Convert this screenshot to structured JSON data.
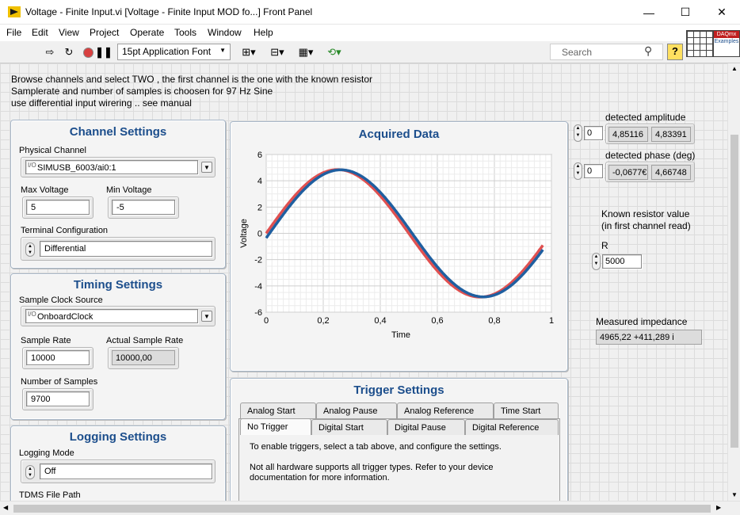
{
  "window": {
    "title": "Voltage - Finite Input.vi [Voltage - Finite Input MOD fo...] Front Panel",
    "minimize": "—",
    "maximize": "☐",
    "close": "✕"
  },
  "menu": [
    "File",
    "Edit",
    "View",
    "Project",
    "Operate",
    "Tools",
    "Window",
    "Help"
  ],
  "toolbar": {
    "font": "15pt Application Font",
    "search_placeholder": "Search"
  },
  "intro": [
    "Browse channels and select TWO , the first channel is the one with the known resistor",
    "Samplerate and number of samples is choosen for 97 Hz  Sine",
    "use differential input wirering .. see manual"
  ],
  "channel_settings": {
    "title": "Channel Settings",
    "physical_channel_label": "Physical Channel",
    "physical_channel": "SIMUSB_6003/ai0:1",
    "max_voltage_label": "Max Voltage",
    "max_voltage": "5",
    "min_voltage_label": "Min Voltage",
    "min_voltage": "-5",
    "terminal_label": "Terminal Configuration",
    "terminal": "Differential"
  },
  "timing_settings": {
    "title": "Timing Settings",
    "clock_source_label": "Sample Clock Source",
    "clock_source": "OnboardClock",
    "sample_rate_label": "Sample Rate",
    "sample_rate": "10000",
    "actual_rate_label": "Actual Sample Rate",
    "actual_rate": "10000,00",
    "num_samples_label": "Number of Samples",
    "num_samples": "9700"
  },
  "logging_settings": {
    "title": "Logging Settings",
    "mode_label": "Logging Mode",
    "mode": "Off",
    "path_label": "TDMS File Path"
  },
  "chart_data": {
    "type": "line",
    "title": "Acquired Data",
    "xlabel": "Time",
    "ylabel": "Voltage",
    "xlim": [
      0,
      1
    ],
    "ylim": [
      -6,
      6
    ],
    "xticks": [
      "0",
      "0,2",
      "0,4",
      "0,6",
      "0,8",
      "1"
    ],
    "yticks": [
      "6",
      "4",
      "2",
      "0",
      "-2",
      "-4",
      "-6"
    ],
    "grid": true,
    "series": [
      {
        "color": "#e05050",
        "amplitude": 4.85116,
        "frequency": 1,
        "phase_deg": 0
      },
      {
        "color": "#1f5fa0",
        "amplitude": 4.83391,
        "frequency": 1,
        "phase_deg": -4.2
      }
    ]
  },
  "trigger_settings": {
    "title": "Trigger Settings",
    "tabs_row1": [
      "Analog Start",
      "Analog Pause",
      "Analog Reference",
      "Time Start"
    ],
    "tabs_row2": [
      "No Trigger",
      "Digital Start",
      "Digital Pause",
      "Digital Reference"
    ],
    "active_tab": "No Trigger",
    "text1": "To enable triggers, select a tab above, and configure the settings.",
    "text2a": "Not all hardware supports all trigger types. Refer to your device",
    "text2b": "documentation for more information."
  },
  "detected_amplitude": {
    "label": "detected amplitude",
    "index": "0",
    "values": [
      "4,85116",
      "4,83391"
    ]
  },
  "detected_phase": {
    "label": "detected phase (deg)",
    "index": "0",
    "values": [
      "-0,0677€",
      "4,66748"
    ]
  },
  "resistor": {
    "label1": "Known resistor value",
    "label2": "(in first channel read)",
    "name": "R",
    "value": "5000"
  },
  "impedance": {
    "label": "Measured impedance",
    "value": "4965,22 +411,289 i"
  }
}
